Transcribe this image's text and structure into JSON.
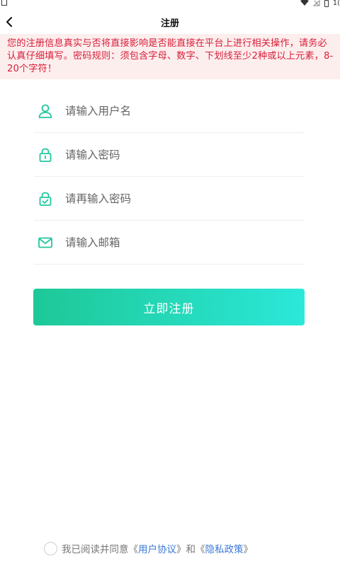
{
  "status_bar": {
    "clipped_text": "1("
  },
  "header": {
    "title": "注册",
    "back_icon": "chevron-left-icon"
  },
  "notice": {
    "text": "您的注册信息真实与否将直接影响是否能直接在平台上进行相关操作，请务必认真仔细填写。密码规则：须包含字母、数字、下划线至少2种或以上元素，8-20个字符！",
    "color": "#d6203a",
    "background": "#fdeeee"
  },
  "form": {
    "fields": [
      {
        "icon": "user-icon",
        "placeholder": "请输入用户名",
        "value": ""
      },
      {
        "icon": "lock-icon",
        "placeholder": "请输入密码",
        "value": ""
      },
      {
        "icon": "lock-check-icon",
        "placeholder": "请再输入密码",
        "value": ""
      },
      {
        "icon": "mail-icon",
        "placeholder": "请输入邮箱",
        "value": ""
      }
    ],
    "accent_color": "#22c7a0"
  },
  "register_button": {
    "label": "立即注册",
    "gradient": [
      "#1ec897",
      "#2be8d9"
    ]
  },
  "agreement": {
    "checked": false,
    "prefix": "我已阅读并同意",
    "user_agreement": "用户协议",
    "conjunction": "和",
    "privacy_policy": "隐私政策",
    "open_bracket": "《",
    "close_bracket": "》",
    "link_color": "#3b78d8"
  }
}
